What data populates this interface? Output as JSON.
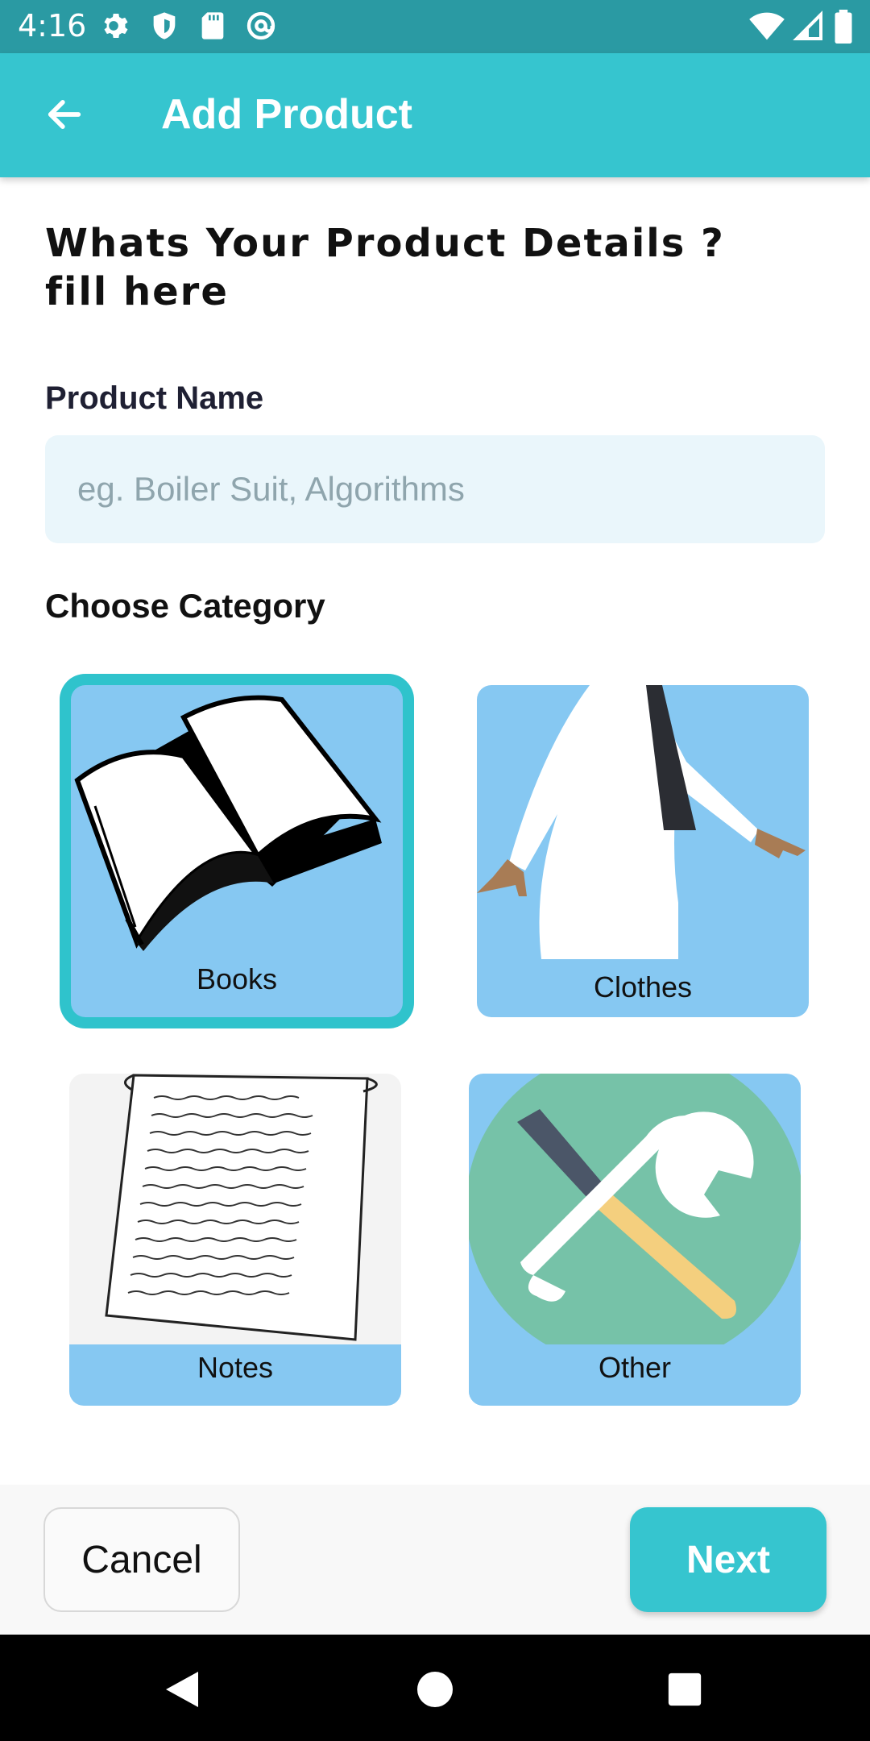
{
  "status_bar": {
    "time": "4:16",
    "left_icons": [
      "settings-icon",
      "shield-icon",
      "sd-card-icon",
      "at-icon"
    ],
    "right_icons": [
      "wifi-icon",
      "signal-icon",
      "battery-icon"
    ],
    "color": "#2a9aa3"
  },
  "app_bar": {
    "title": "Add Product",
    "back_icon": "arrow-left-icon",
    "color": "#36c5cf"
  },
  "form": {
    "heading_line1": "Whats Your Product Details ?",
    "heading_line2": "fill here",
    "product_name_label": "Product Name",
    "product_name_placeholder": "eg. Boiler Suit, Algorithms",
    "product_name_value": "",
    "category_label": "Choose Category"
  },
  "categories": [
    {
      "label": "Books",
      "icon": "open-book-icon",
      "selected": true
    },
    {
      "label": "Clothes",
      "icon": "lab-coat-icon",
      "selected": false
    },
    {
      "label": "Notes",
      "icon": "handwritten-page-icon",
      "selected": false
    },
    {
      "label": "Other",
      "icon": "tools-icon",
      "selected": false
    }
  ],
  "actions": {
    "cancel_label": "Cancel",
    "next_label": "Next"
  },
  "nav_bar": {
    "back_icon": "nav-back-icon",
    "home_icon": "nav-home-icon",
    "recents_icon": "nav-recents-icon"
  },
  "colors": {
    "accent": "#36c5cf",
    "selected_border": "#2fc3cc",
    "tile_background": "#86c8f2",
    "input_background": "#eaf6fb"
  }
}
